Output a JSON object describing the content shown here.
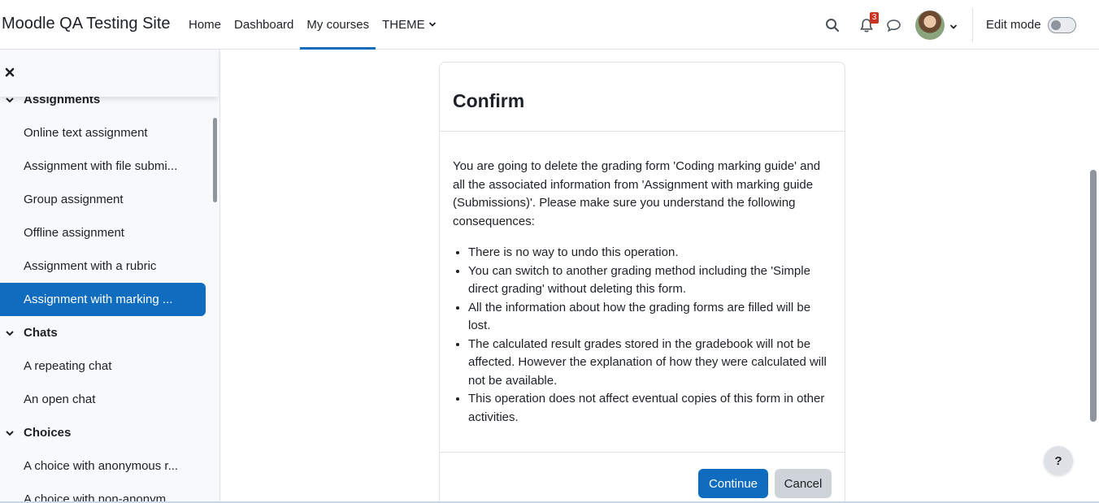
{
  "navbar": {
    "site_name": "Moodle QA Testing Site",
    "links": [
      "Home",
      "Dashboard",
      "My courses",
      "THEME"
    ],
    "active_link": "My courses",
    "notification_count": "3",
    "edit_mode_label": "Edit mode",
    "edit_mode_on": false
  },
  "drawer": {
    "sections": [
      {
        "title": "Assignments",
        "items": [
          "Online text assignment",
          "Assignment with file submi...",
          "Group assignment",
          "Offline assignment",
          "Assignment with a rubric",
          "Assignment with marking ..."
        ]
      },
      {
        "title": "Chats",
        "items": [
          "A repeating chat",
          "An open chat"
        ]
      },
      {
        "title": "Choices",
        "items": [
          "A choice with anonymous r...",
          "A choice with non-anonym..."
        ]
      }
    ],
    "active_item": "Assignment with marking ..."
  },
  "modal": {
    "title": "Confirm",
    "intro": "You are going to delete the grading form 'Coding marking guide' and all the associated information from 'Assignment with marking guide (Submissions)'. Please make sure you understand the following consequences:",
    "consequences": [
      "There is no way to undo this operation.",
      "You can switch to another grading method including the 'Simple direct grading' without deleting this form.",
      "All the information about how the grading forms are filled will be lost.",
      "The calculated result grades stored in the gradebook will not be affected. However the explanation of how they were calculated will not be available.",
      "This operation does not affect eventual copies of this form in other activities."
    ],
    "continue_label": "Continue",
    "cancel_label": "Cancel"
  },
  "help_label": "?",
  "colors": {
    "primary": "#0f6cbf",
    "badge": "#ca3120",
    "text": "#1d2125",
    "drawer_bg": "#f8f9fa"
  }
}
